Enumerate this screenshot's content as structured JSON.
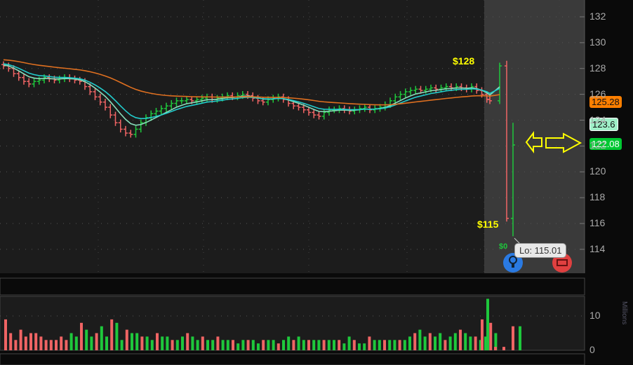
{
  "price_axis": {
    "ticks": [
      132,
      130,
      128,
      126,
      124,
      122,
      120,
      118,
      116,
      114
    ]
  },
  "volume_axis": {
    "ticks": [
      10,
      0
    ],
    "label": "Millions"
  },
  "price_labels": [
    {
      "text": "125.28",
      "color": "#ff7f00"
    },
    {
      "text": "123.6",
      "color": "#9ff0c8"
    },
    {
      "text": "122.08",
      "color": "#00c832"
    }
  ],
  "annotations": {
    "high": "$128",
    "low": "$115",
    "tooltip": "Lo: 115.01",
    "small_label": "$0"
  },
  "colors": {
    "up": "#1ec83c",
    "down": "#f06464",
    "ema_fast": "#88ddbb",
    "ema_mid": "#22cccc",
    "ema_slow": "#e07020"
  },
  "chart_data": {
    "type": "ohlc",
    "closes": [
      128.2,
      128,
      127.6,
      127.3,
      127,
      126.8,
      127,
      127.1,
      127.3,
      127.2,
      127.1,
      127.2,
      127.3,
      127.2,
      127.1,
      127,
      126.6,
      126.2,
      125.8,
      125.4,
      125,
      124.4,
      123.8,
      123.3,
      123,
      122.9,
      123.3,
      123.8,
      124.2,
      124.5,
      124.7,
      124.9,
      125.1,
      125.3,
      125.5,
      125.5,
      125.6,
      125.5,
      125.6,
      125.7,
      125.8,
      125.6,
      125.7,
      125.8,
      125.9,
      125.8,
      125.9,
      126,
      125.9,
      125.7,
      125.5,
      125.4,
      125.6,
      125.7,
      125.8,
      125.6,
      125.3,
      125.1,
      125,
      124.8,
      124.6,
      124.4,
      124.3,
      124.6,
      124.8,
      124.8,
      124.9,
      124.8,
      124.7,
      124.8,
      124.9,
      125,
      124.8,
      124.9,
      125,
      125.2,
      125.5,
      125.8,
      126,
      126.2,
      126.3,
      126.4,
      126.3,
      126.4,
      126.5,
      126.4,
      126.5,
      126.6,
      126.5,
      126.6,
      126.5,
      126.4,
      126.6,
      126.3,
      126,
      125.6,
      125.5,
      128.2,
      116.4,
      122.08
    ],
    "last_high": 128.6,
    "last_low": 115.01,
    "volumes": [
      9,
      5,
      3,
      6,
      4,
      5,
      5,
      4,
      3,
      3,
      3,
      4,
      3,
      5,
      4,
      8,
      6,
      4,
      5,
      7,
      4,
      9,
      8,
      3,
      6,
      5,
      5,
      4,
      4,
      3,
      5,
      4,
      4,
      3,
      3,
      4,
      5,
      4,
      3,
      4,
      3,
      3,
      4,
      3,
      3,
      3,
      2,
      3,
      3,
      3,
      2,
      3,
      3,
      3,
      2,
      3,
      4,
      3,
      4,
      3,
      3,
      3,
      3,
      3,
      3,
      3,
      3,
      2,
      4,
      3,
      2,
      2,
      4,
      3,
      3,
      3,
      3,
      3,
      3,
      3,
      4,
      5,
      6,
      4,
      5,
      4,
      5,
      3,
      4,
      5,
      6,
      5,
      4,
      4,
      3,
      4,
      8,
      5,
      9,
      15,
      1,
      1,
      7,
      7
    ]
  }
}
